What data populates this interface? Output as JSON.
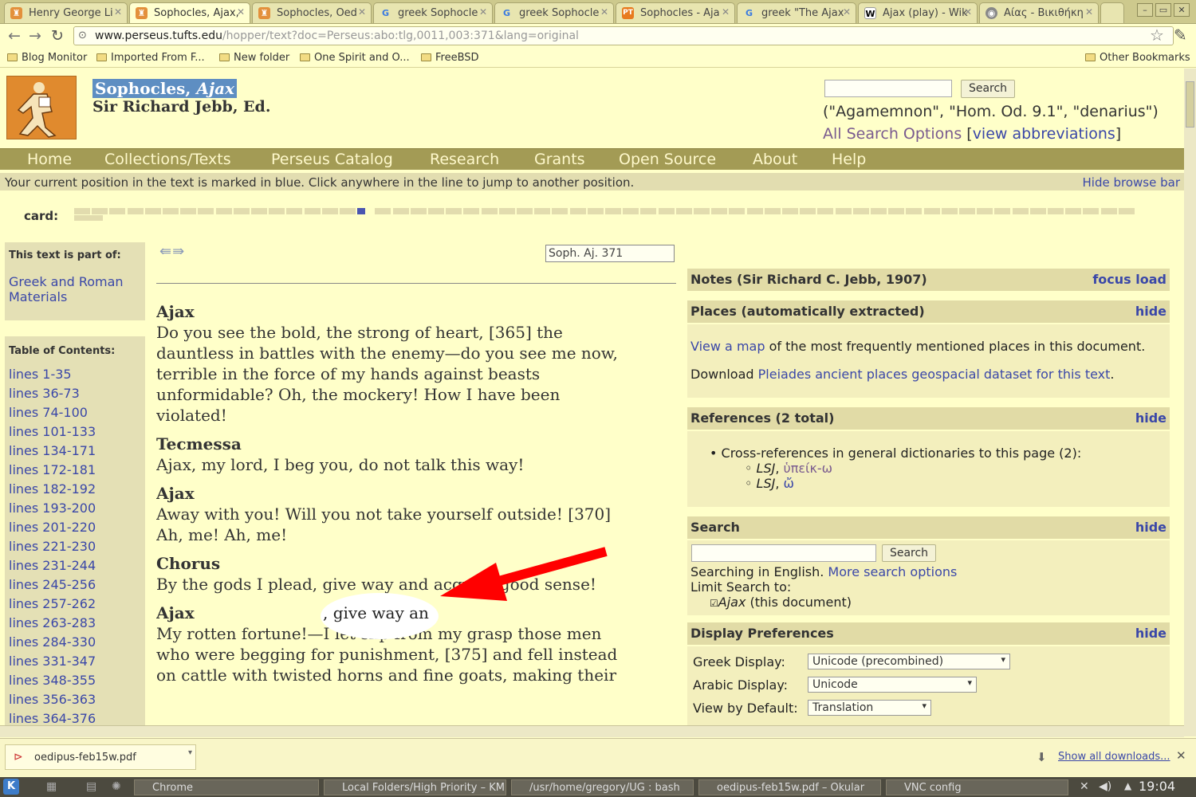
{
  "browser": {
    "tabs": [
      {
        "title": "Henry George Li",
        "icon": "perseus-icon",
        "active": false
      },
      {
        "title": "Sophocles, Ajax,",
        "icon": "perseus-icon",
        "active": true
      },
      {
        "title": "Sophocles, Oed",
        "icon": "perseus-icon",
        "active": false
      },
      {
        "title": "greek Sophocle",
        "icon": "google-icon",
        "active": false
      },
      {
        "title": "greek Sophocle",
        "icon": "google-icon",
        "active": false
      },
      {
        "title": "Sophocles - Aja",
        "icon": "pt-icon",
        "active": false
      },
      {
        "title": "greek \"The Ajax",
        "icon": "google-icon",
        "active": false
      },
      {
        "title": "Ajax (play) - Wik",
        "icon": "wikipedia-icon",
        "active": false
      },
      {
        "title": "Αίας - Βικιθήκη",
        "icon": "wikisource-icon",
        "active": false
      }
    ],
    "url_host": "www.perseus.tufts.edu",
    "url_path": "/hopper/text?doc=Perseus:abo:tlg,0011,003:371&lang=original",
    "bookmarks": [
      "Blog Monitor",
      "Imported From F...",
      "New folder",
      "One Spirit and O...",
      "FreeBSD"
    ],
    "other_bookmarks": "Other Bookmarks"
  },
  "site": {
    "title_main": "Sophocles, ",
    "title_work": "Ajax",
    "editor": "Sir Richard Jebb, Ed.",
    "search_button": "Search",
    "search_hint": "(\"Agamemnon\", \"Hom. Od. 9.1\", \"denarius\")",
    "all_search_options": "All Search Options",
    "view_abbreviations": "view abbreviations",
    "nav": [
      "Home",
      "Collections/Texts",
      "Perseus Catalog",
      "Research",
      "Grants",
      "Open Source",
      "About",
      "Help"
    ],
    "position_notice": "Your current position in the text is marked in blue. Click anywhere in the line to jump to another position.",
    "hide_browse_bar": "Hide browse bar",
    "card_label": "card:"
  },
  "left": {
    "part_of_label": "This text is part of:",
    "part_of_link": "Greek and Roman Materials",
    "toc_label": "Table of Contents:",
    "toc": [
      "lines 1-35",
      "lines 36-73",
      "lines 74-100",
      "lines 101-133",
      "lines 134-171",
      "lines 172-181",
      "lines 182-192",
      "lines 193-200",
      "lines 201-220",
      "lines 221-230",
      "lines 231-244",
      "lines 245-256",
      "lines 257-262",
      "lines 263-283",
      "lines 284-330",
      "lines 331-347",
      "lines 348-355",
      "lines 356-363",
      "lines 364-376"
    ]
  },
  "text": {
    "citation": "Soph. Aj. 371",
    "passages": [
      {
        "speaker": "Ajax",
        "lines": [
          "Do you see the bold, the strong of heart, [365] the",
          "dauntless in battles with the enemy—do you see me now,",
          "terrible in the force of my hands against beasts",
          "unformidable? Oh, the mockery! How I have been",
          "violated!"
        ]
      },
      {
        "speaker": "Tecmessa",
        "lines": [
          "Ajax, my lord, I beg you, do not talk this way!"
        ]
      },
      {
        "speaker": "Ajax",
        "lines": [
          "Away with you! Will you not take yourself outside! [370]",
          "Ah, me! Ah, me!"
        ]
      },
      {
        "speaker": "Chorus",
        "lines": [
          "By the gods I plead, give way and acquire good sense!"
        ]
      },
      {
        "speaker": "Ajax",
        "lines": [
          "My rotten fortune!—I let slip from my grasp those men",
          "who were begging for punishment, [375] and fell instead",
          "on cattle with twisted horns and fine goats, making their"
        ]
      }
    ],
    "highlighted": ", give way an"
  },
  "right": {
    "notes_title": "Notes (Sir Richard C. Jebb, 1907)",
    "notes_focus": "focus",
    "notes_load": "load",
    "places_title": "Places (automatically extracted)",
    "hide": "hide",
    "places_view_link": "View a map",
    "places_view_rest": " of the most frequently mentioned places in this document.",
    "places_download_prefix": "Download ",
    "places_download_link": "Pleiades ancient places geospacial dataset for this text",
    "places_download_suffix": ".",
    "refs_title": "References (2 total)",
    "refs_item": "Cross-references in general dictionaries to this page (2):",
    "refs_sub": [
      {
        "src": "LSJ",
        "word": "ὑπείκ-ω"
      },
      {
        "src": "LSJ",
        "word": "ὤ"
      }
    ],
    "search_title": "Search",
    "search_button": "Search",
    "search_lang_prefix": "Searching in English. ",
    "more_search_options": "More search options",
    "limit_search": "Limit Search to:",
    "limit_doc_title": "Ajax",
    "limit_doc_rest": " (this document)",
    "display_title": "Display Preferences",
    "prefs": [
      {
        "label": "Greek Display:",
        "value": "Unicode (precombined)"
      },
      {
        "label": "Arabic Display:",
        "value": "Unicode"
      },
      {
        "label": "View by Default:",
        "value": "Translation"
      }
    ]
  },
  "downloads": {
    "file": "oedipus-feb15w.pdf",
    "show_all": "Show all downloads..."
  },
  "taskbar": {
    "tasks": [
      "Chrome",
      "Local Folders/High Priority – KM",
      "/usr/home/gregory/UG : bash",
      "oedipus-feb15w.pdf – Okular",
      "VNC config"
    ],
    "clock": "19:04"
  }
}
